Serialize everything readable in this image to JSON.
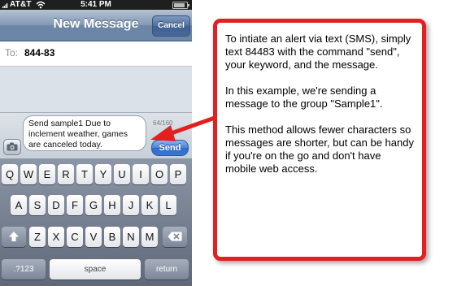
{
  "status_bar": {
    "carrier": "AT&T",
    "time": "5:41 PM",
    "battery_level": 0.85
  },
  "nav_bar": {
    "title": "New Message",
    "cancel_label": "Cancel"
  },
  "recipient": {
    "label": "To:",
    "value": "844-83"
  },
  "compose": {
    "message_lines": [
      "Send sample1 Due to",
      "inclement weather, games",
      "are canceled today."
    ],
    "char_count": "64/160",
    "send_label": "Send",
    "camera_icon": "camera-icon"
  },
  "keyboard": {
    "row1": [
      "Q",
      "W",
      "E",
      "R",
      "T",
      "Y",
      "U",
      "I",
      "O",
      "P"
    ],
    "row2": [
      "A",
      "S",
      "D",
      "F",
      "G",
      "H",
      "J",
      "K",
      "L"
    ],
    "row3": [
      "Z",
      "X",
      "C",
      "V",
      "B",
      "N",
      "M"
    ],
    "shift_icon": "shift-arrow-icon",
    "delete_icon": "backspace-icon",
    "numbers_label": ".?123",
    "space_label": "space",
    "return_label": "return"
  },
  "callout": {
    "paragraphs": [
      "To intiate an alert via text (SMS), simply text 84483  with the command \"send\", your keyword, and the message.",
      "In this example, we're sending a message to the group \"Sample1\".",
      "This method allows fewer characters so messages are shorter, but can be handy if you're on the go and don't have mobile web access."
    ],
    "border_color": "#e32020",
    "arrow_icon": "red-arrow-icon"
  }
}
